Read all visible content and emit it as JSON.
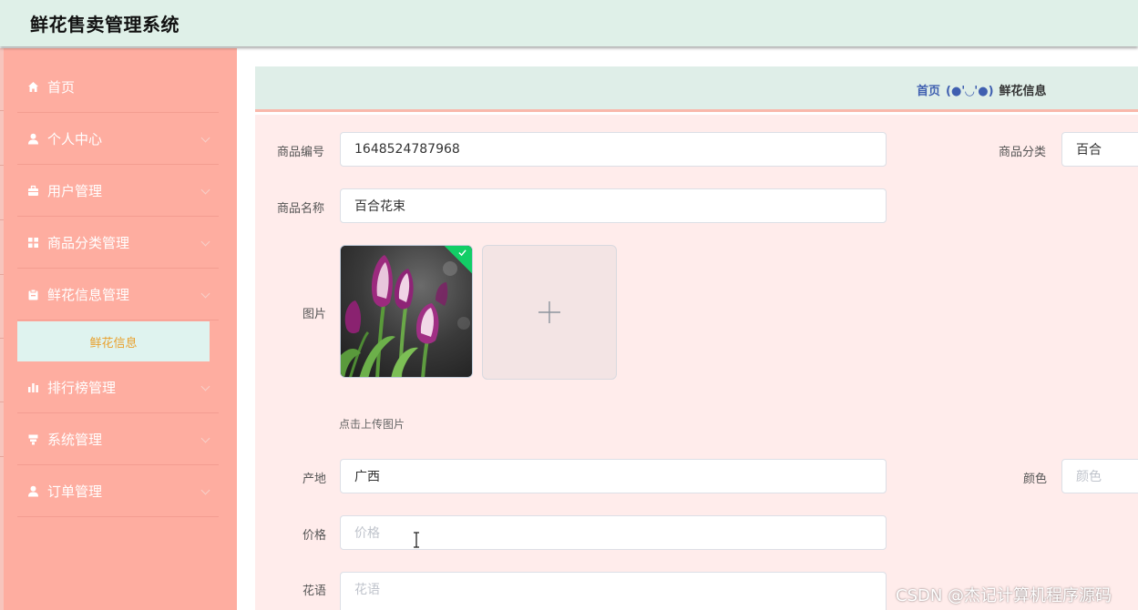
{
  "app": {
    "title": "鲜花售卖管理系统"
  },
  "sidebar": {
    "items": [
      {
        "label": "首页",
        "icon": "home-icon"
      },
      {
        "label": "个人中心",
        "icon": "person-icon"
      },
      {
        "label": "用户管理",
        "icon": "briefcase-icon"
      },
      {
        "label": "商品分类管理",
        "icon": "grid-icon"
      },
      {
        "label": "鲜花信息管理",
        "icon": "clipboard-icon"
      },
      {
        "label": "排行榜管理",
        "icon": "bar-chart-icon"
      },
      {
        "label": "系统管理",
        "icon": "podium-icon"
      },
      {
        "label": "订单管理",
        "icon": "person-icon"
      }
    ],
    "active_sub_item": "鲜花信息"
  },
  "breadcrumb": {
    "home": "首页",
    "separator": "(●'◡'●)",
    "current": "鲜花信息"
  },
  "form": {
    "code_label": "商品编号",
    "code_value": "1648524787968",
    "category_label": "商品分类",
    "category_value": "百合",
    "name_label": "商品名称",
    "name_value": "百合花束",
    "image_label": "图片",
    "upload_hint": "点击上传图片",
    "origin_label": "产地",
    "origin_value": "广西",
    "color_label": "颜色",
    "color_placeholder": "颜色",
    "price_label": "价格",
    "price_placeholder": "价格",
    "flower_language_label": "花语",
    "flower_language_placeholder": "花语"
  },
  "watermark": "CSDN @杰记计算机程序源码",
  "colors": {
    "header_bg": "#dff0e8",
    "sidebar_bg": "#feada0",
    "active_sub_bg": "#dff3ef",
    "active_sub_text": "#e9a02c",
    "form_bg": "#ffeceb",
    "breadcrumb_link": "#3f5fb0",
    "success_green": "#13ce66"
  }
}
